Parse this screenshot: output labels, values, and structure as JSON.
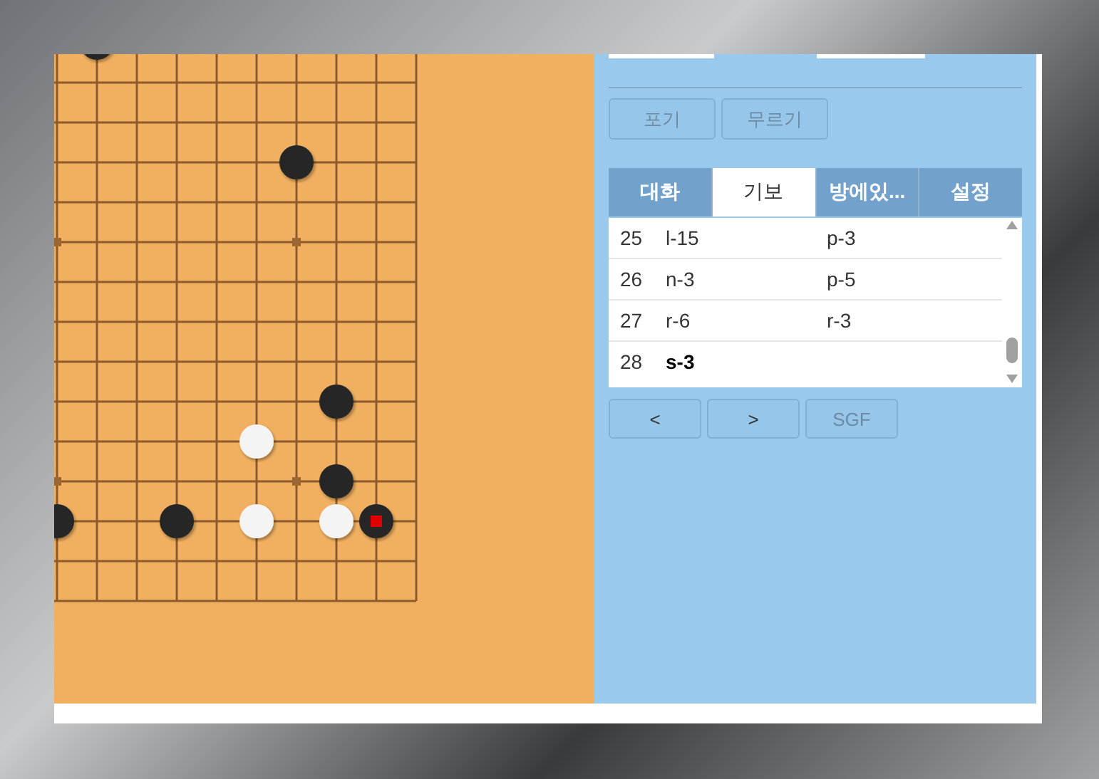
{
  "game_buttons": [
    {
      "label": "포기",
      "disabled": true
    },
    {
      "label": "무르기",
      "disabled": true
    }
  ],
  "tabs": [
    {
      "label": "대화",
      "selected": false
    },
    {
      "label": "기보",
      "selected": true
    },
    {
      "label": "방에있...",
      "selected": false
    },
    {
      "label": "설정",
      "selected": false
    }
  ],
  "moves": [
    {
      "number": "25",
      "black": "l-15",
      "white": "p-3",
      "current": false
    },
    {
      "number": "26",
      "black": "n-3",
      "white": "p-5",
      "current": false
    },
    {
      "number": "27",
      "black": "r-6",
      "white": "r-3",
      "current": false
    },
    {
      "number": "28",
      "black": "s-3",
      "current": true
    }
  ],
  "nav_buttons": [
    {
      "label": "<",
      "disabled": false
    },
    {
      "label": ">",
      "disabled": false
    },
    {
      "label": "SGF",
      "disabled": true
    }
  ]
}
